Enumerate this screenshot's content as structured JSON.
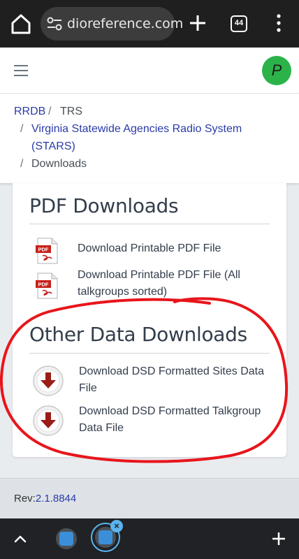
{
  "browser": {
    "url": "dioreference.com",
    "tab_count": "44"
  },
  "header": {
    "avatar_letter": "P"
  },
  "breadcrumb": {
    "root": "RRDB",
    "sep1": "/",
    "level1": "TRS",
    "sep2": "/",
    "level2": "Virginia Statewide Agencies Radio System",
    "level2_cont": "(STARS)",
    "sep3": "/",
    "current": "Downloads"
  },
  "pdf_section": {
    "title": "PDF Downloads",
    "items": [
      {
        "line1": "Download Printable PDF File",
        "line2": ""
      },
      {
        "line1": "Download Printable PDF File (All",
        "line2": "talkgroups sorted)"
      }
    ]
  },
  "other_section": {
    "title": "Other Data Downloads",
    "items": [
      {
        "line1": "Download DSD Formatted Sites Data",
        "line2": "File"
      },
      {
        "line1": "Download DSD Formatted Talkgroup",
        "line2": "Data File"
      }
    ]
  },
  "footer": {
    "rev_label": "Rev:",
    "rev_value": "2.1.8844"
  },
  "colors": {
    "link": "#2a3ba8",
    "avatar": "#2bb34a",
    "annotation": "#e8151b",
    "pdf_red": "#c8211b"
  }
}
